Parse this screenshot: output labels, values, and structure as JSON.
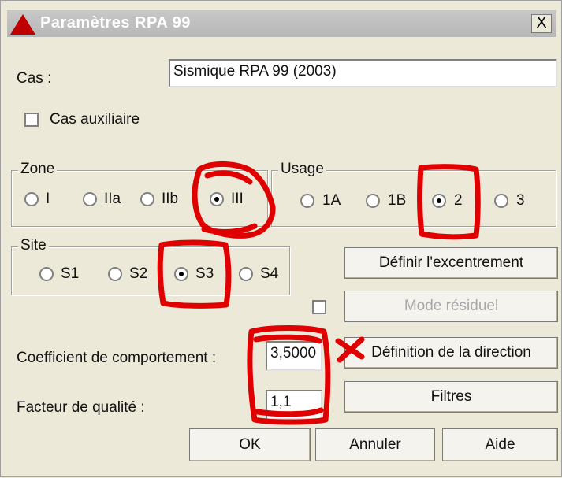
{
  "window": {
    "title": "Paramètres RPA 99",
    "close_label": "X"
  },
  "cas": {
    "label": "Cas :",
    "value": "Sismique RPA 99 (2003)"
  },
  "cas_auxiliaire": {
    "label": "Cas auxiliaire",
    "checked": false
  },
  "zone": {
    "label": "Zone",
    "options": [
      "I",
      "IIa",
      "IIb",
      "III"
    ],
    "selected": "III"
  },
  "usage": {
    "label": "Usage",
    "options": [
      "1A",
      "1B",
      "2",
      "3"
    ],
    "selected": "2"
  },
  "site": {
    "label": "Site",
    "options": [
      "S1",
      "S2",
      "S3",
      "S4"
    ],
    "selected": "S3"
  },
  "buttons": {
    "excentrement": "Définir l'excentrement",
    "mode_residuel": "Mode résiduel",
    "direction": "Définition de la direction",
    "filtres": "Filtres",
    "ok": "OK",
    "annuler": "Annuler",
    "aide": "Aide"
  },
  "coefficient": {
    "label": "Coefficient de comportement :",
    "value": "3,5000"
  },
  "facteur": {
    "label": "Facteur de qualité :",
    "value": "1,1"
  },
  "mode_residuel_checked": false,
  "colors": {
    "annotation": "#e00000",
    "title_bar": "#b9b9b9"
  }
}
